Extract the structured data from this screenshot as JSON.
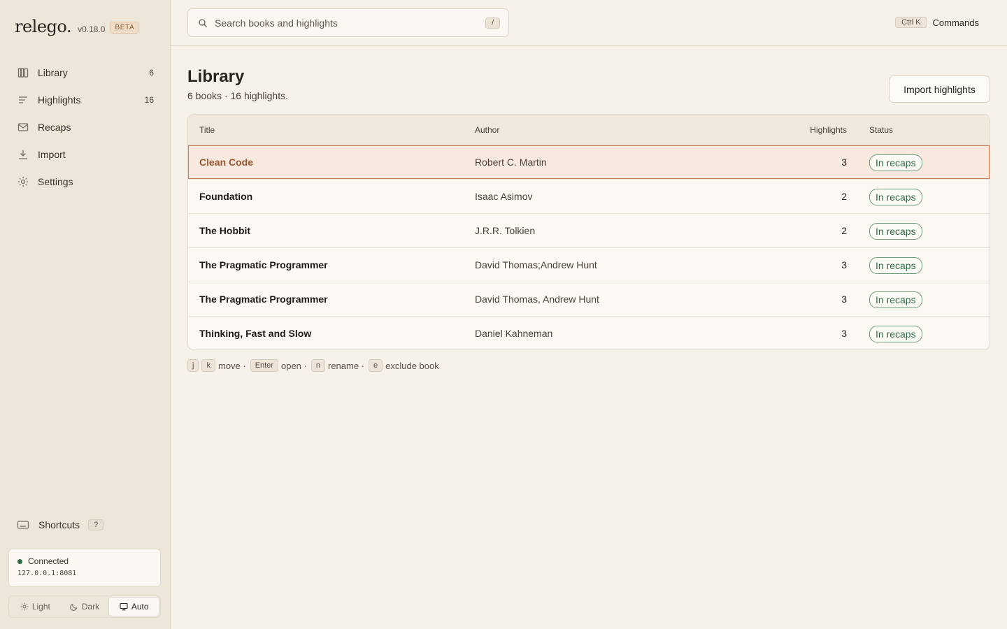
{
  "app": {
    "logo": "relego.",
    "version": "v0.18.0",
    "beta": "BETA"
  },
  "sidebar": {
    "items": [
      {
        "label": "Library",
        "count": "6",
        "icon": "library-icon"
      },
      {
        "label": "Highlights",
        "count": "16",
        "icon": "highlights-icon"
      },
      {
        "label": "Recaps",
        "count": "",
        "icon": "mail-icon"
      },
      {
        "label": "Import",
        "count": "",
        "icon": "download-icon"
      },
      {
        "label": "Settings",
        "count": "",
        "icon": "gear-icon"
      }
    ],
    "shortcuts_label": "Shortcuts",
    "shortcuts_key": "?",
    "connection": {
      "status": "Connected",
      "address": "127.0.0.1:8081",
      "status_color": "#2f6b45"
    },
    "theme": {
      "options": [
        "Light",
        "Dark",
        "Auto"
      ],
      "selected": "Auto"
    }
  },
  "topbar": {
    "search_placeholder": "Search books and highlights",
    "search_key": "/",
    "commands_key": "Ctrl K",
    "commands_label": "Commands"
  },
  "main": {
    "title": "Library",
    "subtitle": "6 books · 16 highlights.",
    "import_button": "Import highlights",
    "table": {
      "headers": {
        "title": "Title",
        "author": "Author",
        "highlights": "Highlights",
        "status": "Status"
      },
      "rows": [
        {
          "title": "Clean Code",
          "author": "Robert C. Martin",
          "highlights": "3",
          "status": "In recaps",
          "selected": true
        },
        {
          "title": "Foundation",
          "author": "Isaac Asimov",
          "highlights": "2",
          "status": "In recaps"
        },
        {
          "title": "The Hobbit",
          "author": "J.R.R. Tolkien",
          "highlights": "2",
          "status": "In recaps"
        },
        {
          "title": "The Pragmatic Programmer",
          "author": "David Thomas;Andrew Hunt",
          "highlights": "3",
          "status": "In recaps"
        },
        {
          "title": "The Pragmatic Programmer",
          "author": "David Thomas, Andrew Hunt",
          "highlights": "3",
          "status": "In recaps"
        },
        {
          "title": "Thinking, Fast and Slow",
          "author": "Daniel Kahneman",
          "highlights": "3",
          "status": "In recaps"
        }
      ]
    },
    "hints": {
      "k1": "j",
      "k2": "k",
      "t1": "move ·",
      "k3": "Enter",
      "t2": "open ·",
      "k4": "n",
      "t3": "rename ·",
      "k5": "e",
      "t4": "exclude book"
    }
  },
  "colors": {
    "accent": "#9a5430",
    "selection_border": "#c77f52",
    "status_green": "#2f6b45",
    "background": "#f6f1e9",
    "sidebar": "#efe6da"
  }
}
